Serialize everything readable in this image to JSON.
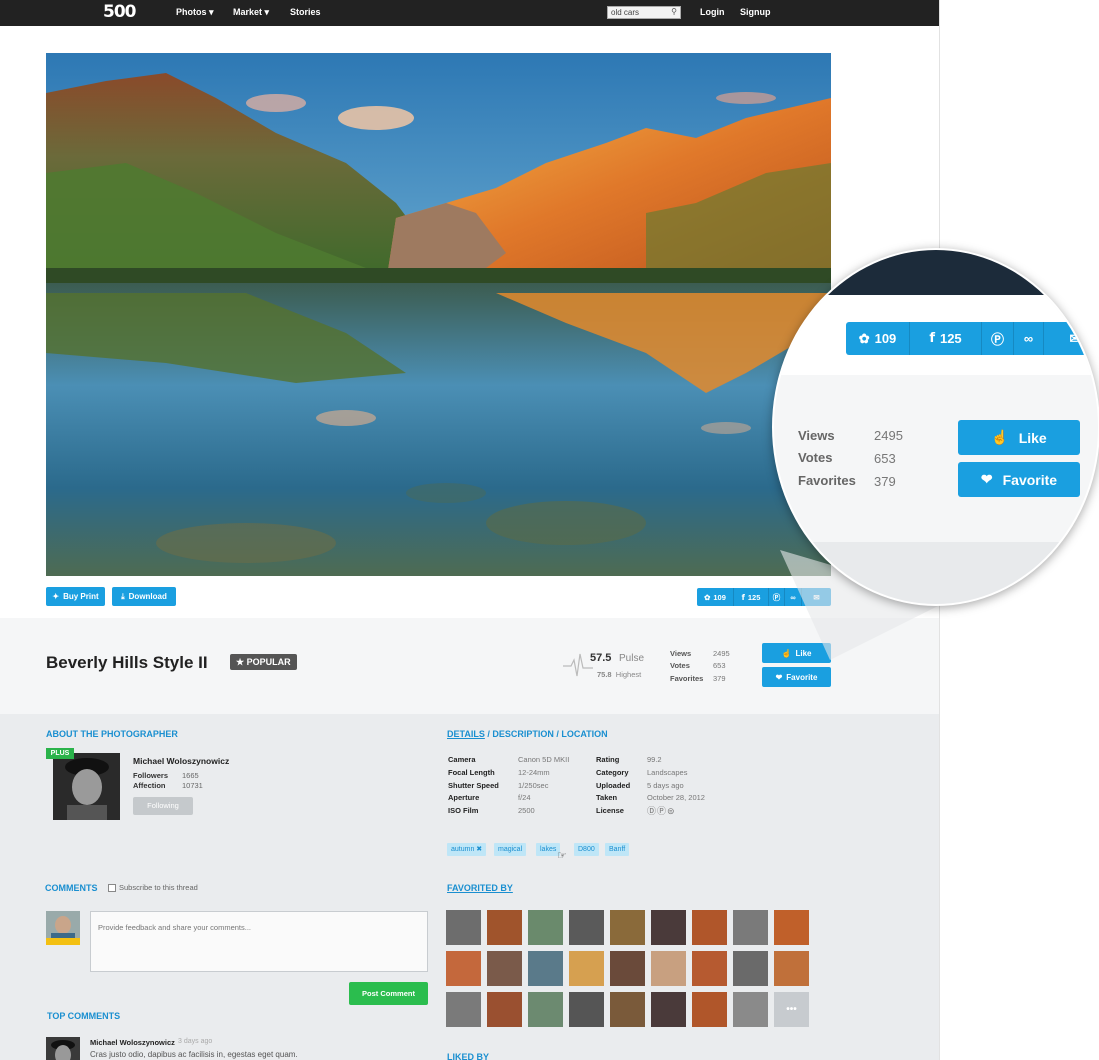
{
  "nav": {
    "logo": "500",
    "photos_label": "Photos ▾",
    "market_label": "Market ▾",
    "stories_label": "Stories",
    "search_value": "old cars",
    "login_label": "Login",
    "signup_label": "Signup"
  },
  "actions": {
    "buy_print_label": "Buy Print",
    "download_label": "Download"
  },
  "share": {
    "twitter_count": "109",
    "facebook_count": "125"
  },
  "photo": {
    "title": "Beverly Hills Style II",
    "badge": "POPULAR",
    "pulse_value": "57.5",
    "pulse_label": "Pulse",
    "highest_value": "75.8",
    "highest_label": "Highest",
    "views_label": "Views",
    "views_value": "2495",
    "votes_label": "Votes",
    "votes_value": "653",
    "favorites_label": "Favorites",
    "favorites_value": "379",
    "like_label": "Like",
    "favorite_label": "Favorite"
  },
  "photographer": {
    "section_title": "ABOUT THE PHOTOGRAPHER",
    "badge": "PLUS",
    "name": "Michael Woloszynowicz",
    "followers_label": "Followers",
    "followers_value": "1665",
    "affection_label": "Affection",
    "affection_value": "10731",
    "following_label": "Following"
  },
  "details": {
    "section_title_details": "DETAILS",
    "section_title_rest": " / DESCRIPTION / LOCATION",
    "left": [
      {
        "label": "Camera",
        "value": "Canon 5D MKII"
      },
      {
        "label": "Focal Length",
        "value": "12-24mm"
      },
      {
        "label": "Shutter Speed",
        "value": "1/250sec"
      },
      {
        "label": "Aperture",
        "value": "f/24"
      },
      {
        "label": "ISO Film",
        "value": "2500"
      }
    ],
    "right": [
      {
        "label": "Rating",
        "value": "99.2"
      },
      {
        "label": "Category",
        "value": "Landscapes"
      },
      {
        "label": "Uploaded",
        "value": "5 days ago"
      },
      {
        "label": "Taken",
        "value": "October 28, 2012"
      },
      {
        "label": "License",
        "value": ""
      }
    ],
    "tags": [
      "autumn ✖",
      "magical",
      "lakes",
      "D800",
      "Banff"
    ]
  },
  "comments": {
    "section_title": "COMMENTS",
    "subscribe_label": "Subscribe to this thread",
    "placeholder": "Provide feedback and share your comments...",
    "post_label": "Post Comment",
    "top_title": "TOP COMMENTS",
    "top_author": "Michael Woloszynowicz",
    "top_time": "3 days ago",
    "top_text": "Cras justo odio, dapibus ac facilisis in, egestas eget quam."
  },
  "favorited": {
    "section_title": "FAVORITED BY",
    "more_label": "•••",
    "liked_title": "LIKED BY"
  },
  "colors": {
    "accent": "#1a9fe0",
    "link": "#1a8fd0",
    "green": "#2bbd4e",
    "nav_bg": "#222222"
  }
}
